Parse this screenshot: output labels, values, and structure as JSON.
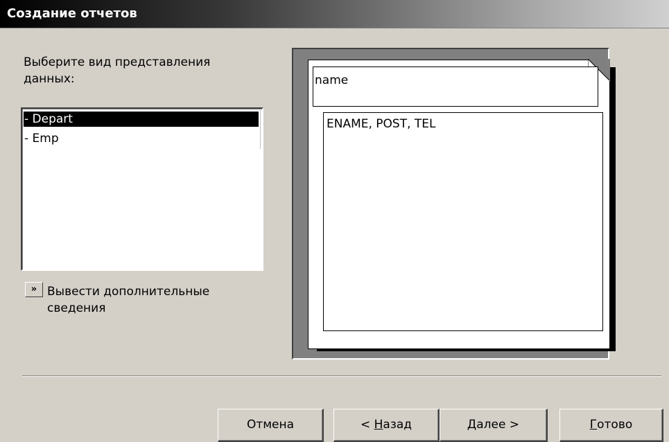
{
  "window": {
    "title": "Создание отчетов"
  },
  "prompt": "Выберите вид представления данных:",
  "list": {
    "items": [
      {
        "label": "- Depart",
        "selected": true
      },
      {
        "label": "- Emp",
        "selected": false
      }
    ]
  },
  "more_info": {
    "button_glyph": "»",
    "label": "Вывести дополнительные сведения"
  },
  "preview": {
    "header_text": "name",
    "fields_text": "ENAME, POST, TEL"
  },
  "buttons": {
    "cancel": "Отмена",
    "back_prefix": "< ",
    "back_hotkey": "Н",
    "back_rest": "азад",
    "next_hotkey": "Д",
    "next_rest": "алее >",
    "finish_hotkey": "Г",
    "finish_rest": "отово"
  }
}
